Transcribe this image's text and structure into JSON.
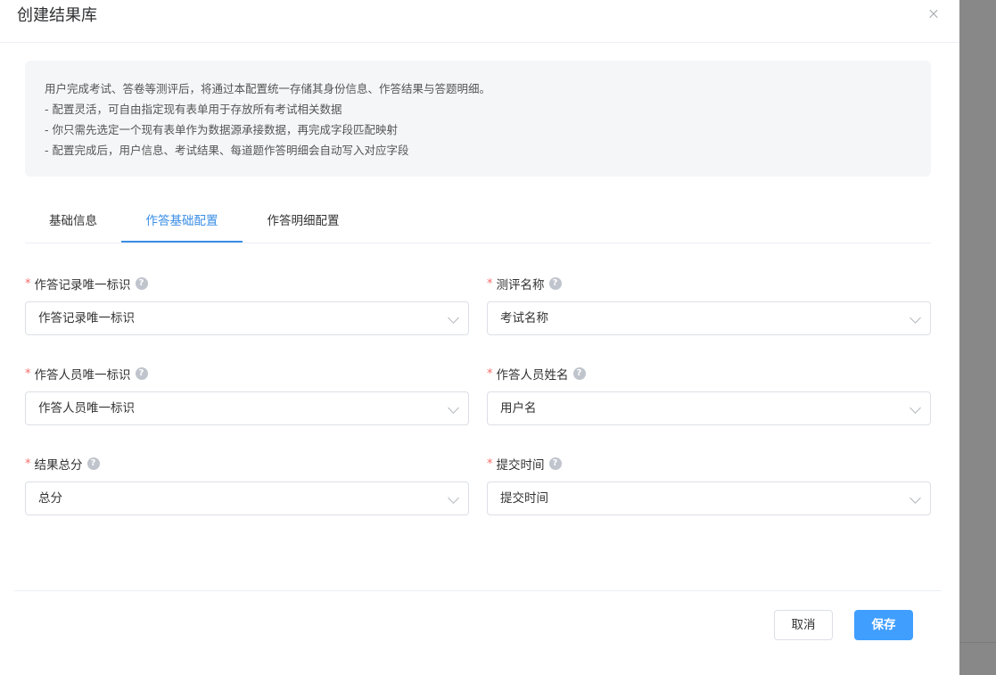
{
  "modal": {
    "title": "创建结果库"
  },
  "notice": {
    "lines": [
      "用户完成考试、答卷等测评后，将通过本配置统一存储其身份信息、作答结果与答题明细。",
      "- 配置灵活，可自由指定现有表单用于存放所有考试相关数据",
      "- 你只需先选定一个现有表单作为数据源承接数据，再完成字段匹配映射",
      "- 配置完成后，用户信息、考试结果、每道题作答明细会自动写入对应字段"
    ]
  },
  "tabs": [
    {
      "label": "基础信息",
      "active": false
    },
    {
      "label": "作答基础配置",
      "active": true
    },
    {
      "label": "作答明细配置",
      "active": false
    }
  ],
  "form": {
    "required_mark": "*",
    "help_glyph": "?",
    "fields": [
      {
        "label": "作答记录唯一标识",
        "value": "作答记录唯一标识"
      },
      {
        "label": "测评名称",
        "value": "考试名称"
      },
      {
        "label": "作答人员唯一标识",
        "value": "作答人员唯一标识"
      },
      {
        "label": "作答人员姓名",
        "value": "用户名"
      },
      {
        "label": "结果总分",
        "value": "总分"
      },
      {
        "label": "提交时间",
        "value": "提交时间"
      }
    ]
  },
  "footer": {
    "cancel_label": "取消",
    "save_label": "保存"
  },
  "colors": {
    "accent": "#409eff",
    "required": "#f56c6c",
    "notice_bg": "#f5f6f8",
    "backdrop": "#888888"
  }
}
